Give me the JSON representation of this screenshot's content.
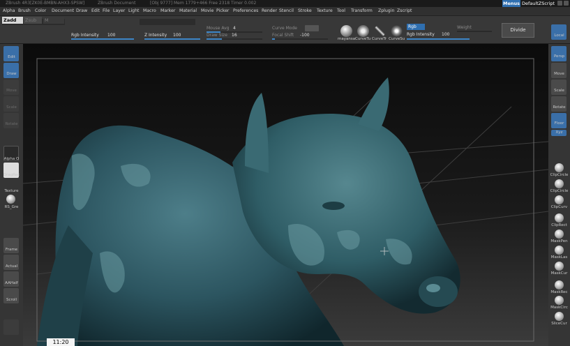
{
  "titlebar": {
    "app": "ZBrush 4R3[ZK0E-BMBN-AHX3-SPSW]",
    "document": "ZBrush Document",
    "stats": "[Obj 9777] Mem 1779+466 Free 2318 Timer 0.002",
    "menus_label": "Menus",
    "script_label": "DefaultZScript"
  },
  "menubar": [
    "Alpha",
    "Brush",
    "Color",
    "Document",
    "Draw",
    "Edit",
    "File",
    "Layer",
    "Light",
    "Macro",
    "Marker",
    "Material",
    "Movie",
    "Picker",
    "Preferences",
    "Render",
    "Stencil",
    "Stroke",
    "Texture",
    "Tool",
    "Transform",
    "Zplugin",
    "Zscript"
  ],
  "toolbar": {
    "zadd": "Zadd",
    "zsub": "Zsub",
    "m": "M",
    "rgb_intensity_label": "Rgb Intensity",
    "rgb_intensity_value": "100",
    "z_intensity_label": "Z Intensity",
    "z_intensity_value": "100",
    "mouse_avg_label": "Mouse Avg",
    "mouse_avg_value": "4",
    "draw_size_label": "Draw Size",
    "draw_size_value": "16",
    "curve_mode_label": "Curve Mode",
    "focal_shift_label": "Focal Shift",
    "focal_shift_value": "-100",
    "rgb_label": "Rgb",
    "rgb_intensity2_label": "Rgb Intensity",
    "rgb_intensity2_value": "100",
    "weight_label": "Weight",
    "divide_label": "Divide",
    "brushes": [
      "mayansa",
      "CurveTu",
      "CurveTr",
      "CurveSu"
    ]
  },
  "left_shelf": {
    "edit": "Edit",
    "draw": "Draw",
    "move": "Move",
    "scale": "Scale",
    "rotate": "Rotate",
    "alpha": "Alpha O",
    "dragrec": "DragRec",
    "texture": "Texture",
    "rs_gre": "RS_Gre",
    "frame": "Frame",
    "actual": "Actual",
    "aahalf": "AAHalf",
    "scroll": "Scroll"
  },
  "right_shelf": {
    "local": "Local",
    "persp": "Persp",
    "floor": "Floor",
    "move": "Move",
    "scale": "Scale",
    "rotate": "Rotate",
    "xyz": "Xyz",
    "items": [
      "ClipCircle",
      "ClipCircle",
      "ClipCurv",
      "ClipRect",
      "MaskPen",
      "MaskLas",
      "MaskCur",
      "MaskRec",
      "MaskCirc",
      "SliceCur"
    ]
  },
  "clock": "11:20",
  "colors": {
    "accent": "#3a6fa8",
    "model": "#2f5a66"
  }
}
